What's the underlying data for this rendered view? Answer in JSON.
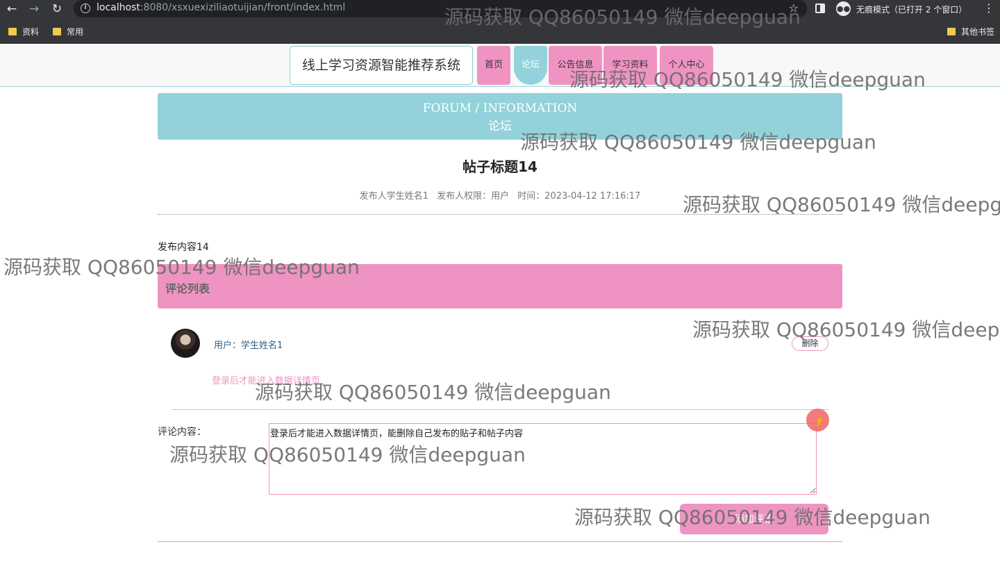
{
  "browser": {
    "back": "←",
    "forward": "→",
    "reload": "↻",
    "url_host": "localhost",
    "url_path": ":8080/xsxuexiziliaotuijian/front/index.html",
    "star": "☆",
    "incognito_label": "无痕模式（已打开 2 个窗口）",
    "menu": "⋮",
    "bookmarks": [
      "资料",
      "常用"
    ],
    "other_bookmarks": "其他书签"
  },
  "site": {
    "brand": "线上学习资源智能推荐系统",
    "nav": [
      "首页",
      "论坛",
      "公告信息",
      "学习资料",
      "个人中心"
    ],
    "active_nav": "论坛",
    "accent_pink": "#ef94c2",
    "accent_teal": "#93d2da"
  },
  "banner": {
    "en": "FORUM / INFORMATION",
    "cn": "论坛"
  },
  "post": {
    "title": "帖子标题14",
    "author": "发布人学生姓名1",
    "role": "发布人权限：用户",
    "time": "时间：2023-04-12 17:16:17",
    "content": "发布内容14"
  },
  "comments": {
    "header": "评论列表",
    "items": [
      {
        "user": "用户：学生姓名1",
        "text": "登录后才能进入数据详情页",
        "delete_label": "删除"
      }
    ]
  },
  "form": {
    "label": "评论内容：",
    "value": "登录后才能进入数据详情页，能删除自己发布的贴子和帖子内容",
    "submit": "添加评论"
  },
  "watermark": "源码获取 QQ86050149 微信deepguan"
}
